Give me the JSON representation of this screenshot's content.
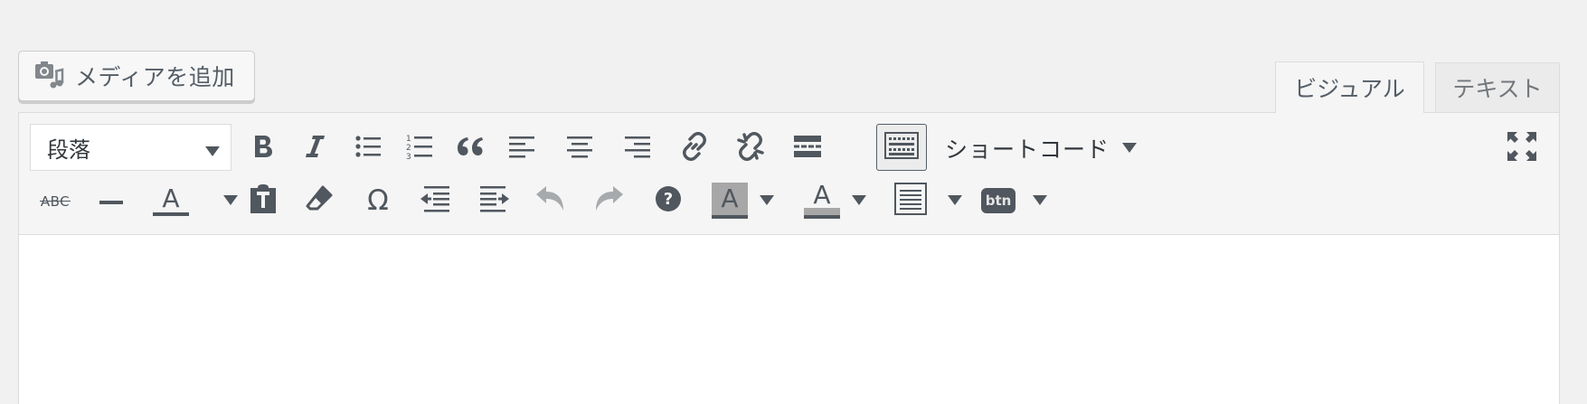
{
  "media_button": {
    "label": "メディアを追加",
    "icon": "camera-music-icon"
  },
  "tabs": [
    {
      "label": "ビジュアル",
      "active": true
    },
    {
      "label": "テキスト",
      "active": false
    }
  ],
  "toolbar": {
    "format_select": {
      "value": "段落"
    },
    "row1_buttons": [
      {
        "name": "bold",
        "icon": "bold-icon"
      },
      {
        "name": "italic",
        "icon": "italic-icon"
      },
      {
        "name": "bullet-list",
        "icon": "bullet-list-icon"
      },
      {
        "name": "numbered-list",
        "icon": "numbered-list-icon"
      },
      {
        "name": "blockquote",
        "icon": "quote-icon"
      },
      {
        "name": "align-left",
        "icon": "align-left-icon"
      },
      {
        "name": "align-center",
        "icon": "align-center-icon"
      },
      {
        "name": "align-right",
        "icon": "align-right-icon"
      },
      {
        "name": "insert-link",
        "icon": "link-icon"
      },
      {
        "name": "remove-link",
        "icon": "unlink-icon"
      },
      {
        "name": "insert-more",
        "icon": "read-more-icon"
      },
      {
        "name": "toolbar-toggle",
        "icon": "keyboard-icon",
        "pressed": true
      }
    ],
    "shortcode_label": "ショートコード",
    "fullscreen_icon": "fullscreen-icon",
    "strikethrough_text": "ABC",
    "row2_buttons": [
      {
        "name": "strikethrough",
        "icon": "strikethrough-icon"
      },
      {
        "name": "horizontal-line",
        "icon": "hr-icon"
      },
      {
        "name": "text-color",
        "icon": "text-color-icon",
        "letter": "A"
      },
      {
        "name": "paste-as-text",
        "icon": "paste-text-icon"
      },
      {
        "name": "clear-formatting",
        "icon": "eraser-icon"
      },
      {
        "name": "special-character",
        "icon": "omega-icon",
        "letter": "Ω"
      },
      {
        "name": "outdent",
        "icon": "outdent-icon"
      },
      {
        "name": "indent",
        "icon": "indent-icon"
      },
      {
        "name": "undo",
        "icon": "undo-icon"
      },
      {
        "name": "redo",
        "icon": "redo-icon"
      },
      {
        "name": "help",
        "icon": "help-icon"
      },
      {
        "name": "background-color",
        "icon": "bg-color-icon",
        "letter": "A"
      },
      {
        "name": "text-highlight",
        "icon": "highlight-icon",
        "letter": "A"
      },
      {
        "name": "table",
        "icon": "table-icon"
      },
      {
        "name": "button-insert",
        "icon": "btn-icon",
        "letter": "btn"
      }
    ]
  },
  "colors": {
    "icon": "#50575e",
    "disabled": "#a7aaad",
    "border": "#dcdcde"
  }
}
